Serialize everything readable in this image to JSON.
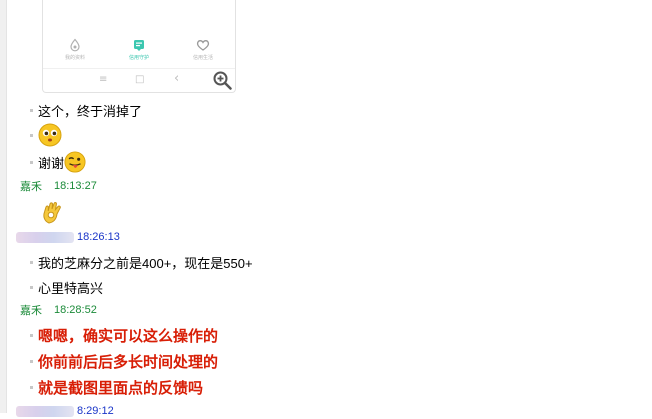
{
  "phone_screenshot": {
    "tabs": [
      {
        "label": "我的资料",
        "icon": "wallet-icon",
        "active": false
      },
      {
        "label": "信用守护",
        "icon": "shield-icon",
        "active": true
      },
      {
        "label": "信用生活",
        "icon": "heart-icon",
        "active": false
      }
    ],
    "nav": {
      "menu": "≡",
      "home": "□",
      "back": "‹"
    },
    "accent": "#3cc7b0"
  },
  "zoom_icon": "zoom-in-icon",
  "messages": [
    {
      "text": "这个，终于消掉了"
    },
    {
      "emoji": "happy-face-emoji"
    },
    {
      "text": "谢谢",
      "emoji": "tongue-face-emoji"
    },
    {
      "sender": "嘉禾",
      "time": "18:13:27"
    },
    {
      "emoji": "ok-hand-emoji"
    },
    {
      "sender_blurred": true,
      "time": "18:26:13"
    },
    {
      "text": "我的芝麻分之前是400+，现在是550+"
    },
    {
      "text": "心里特高兴"
    },
    {
      "sender": "嘉禾",
      "time": "18:28:52"
    },
    {
      "text": "嗯嗯，确实可以这么操作的",
      "color": "#d81e06"
    },
    {
      "text": "你前前后后多长时间处理的",
      "color": "#d81e06"
    },
    {
      "text": "就是截图里面点的反馈吗",
      "color": "#d81e06"
    },
    {
      "sender_blurred": true,
      "time": "8:29:12"
    }
  ],
  "colors": {
    "sender": "#1c8b3a",
    "other_time": "#1a35c8",
    "highlight": "#d81e06"
  }
}
